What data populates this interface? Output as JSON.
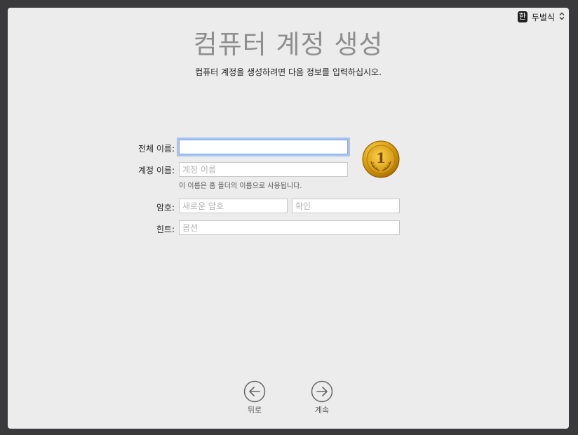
{
  "input_menu": {
    "badge": "한",
    "label": "두벌식",
    "chevron": "⌃⌄"
  },
  "title": "컴퓨터 계정 생성",
  "subtitle": "컴퓨터 계정을 생성하려면 다음 정보를 입력하십시오.",
  "form": {
    "full_name_label": "전체 이름:",
    "full_name_value": "",
    "account_name_label": "계정 이름:",
    "account_name_placeholder": "계정 이름",
    "account_name_note": "이 이름은 홈 폴더의 이름으로 사용됩니다.",
    "password_label": "암호:",
    "password_placeholder": "새로운 암호",
    "verify_placeholder": "확인",
    "hint_label": "힌트:",
    "hint_placeholder": "옵션"
  },
  "avatar": {
    "icon": "gold-medal-number-1",
    "number": "1"
  },
  "nav": {
    "back_label": "뒤로",
    "continue_label": "계속"
  },
  "colors": {
    "focus_ring": "#a4c4f1",
    "title": "#8e8e8e",
    "window_bg": "#ececec"
  }
}
